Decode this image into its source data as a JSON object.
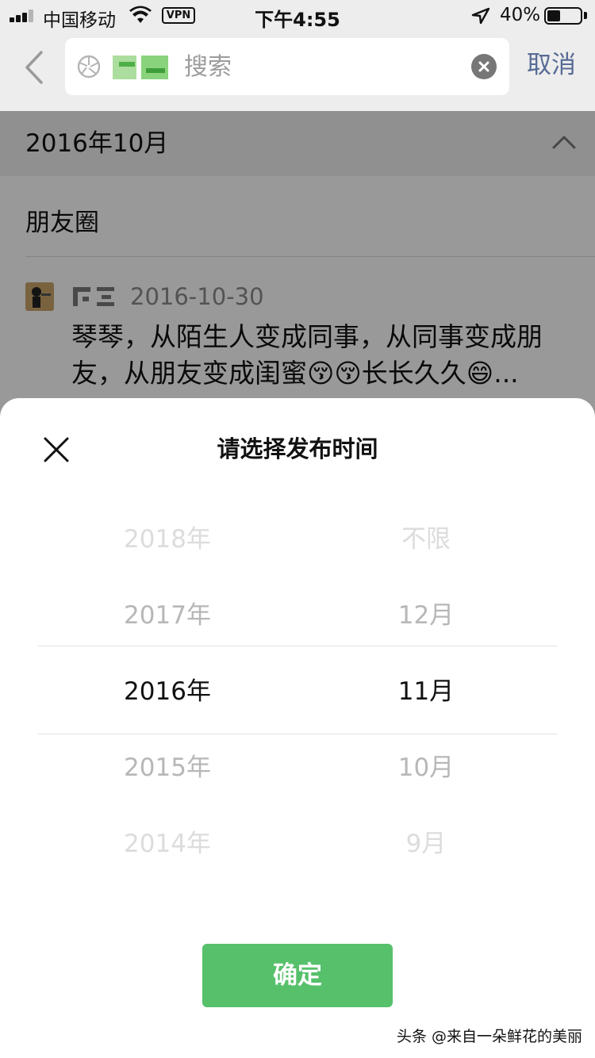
{
  "status_bar": {
    "carrier": "中国移动",
    "vpn": "VPN",
    "time": "下午4:55",
    "battery_percent": "40%",
    "battery_level": 0.4
  },
  "search": {
    "query_text": "搜索",
    "cancel_label": "取消"
  },
  "content": {
    "month_title": "2016年10月",
    "section_title": "朋友圈",
    "post": {
      "date": "2016-10-30",
      "text": "琴琴，从陌生人变成同事，从同事变成朋友，从朋友变成闺蜜😚😚长长久久😄..."
    }
  },
  "sheet": {
    "title": "请选择发布时间",
    "years": [
      "2018年",
      "2017年",
      "2016年",
      "2015年",
      "2014年"
    ],
    "months": [
      "不限",
      "12月",
      "11月",
      "10月",
      "9月"
    ],
    "selected_year": "2016年",
    "selected_month": "11月",
    "confirm_label": "确定"
  },
  "watermark": "头条 @来自一朵鲜花的美丽",
  "colors": {
    "accent_green": "#57c06b",
    "link_blue": "#576b95"
  }
}
